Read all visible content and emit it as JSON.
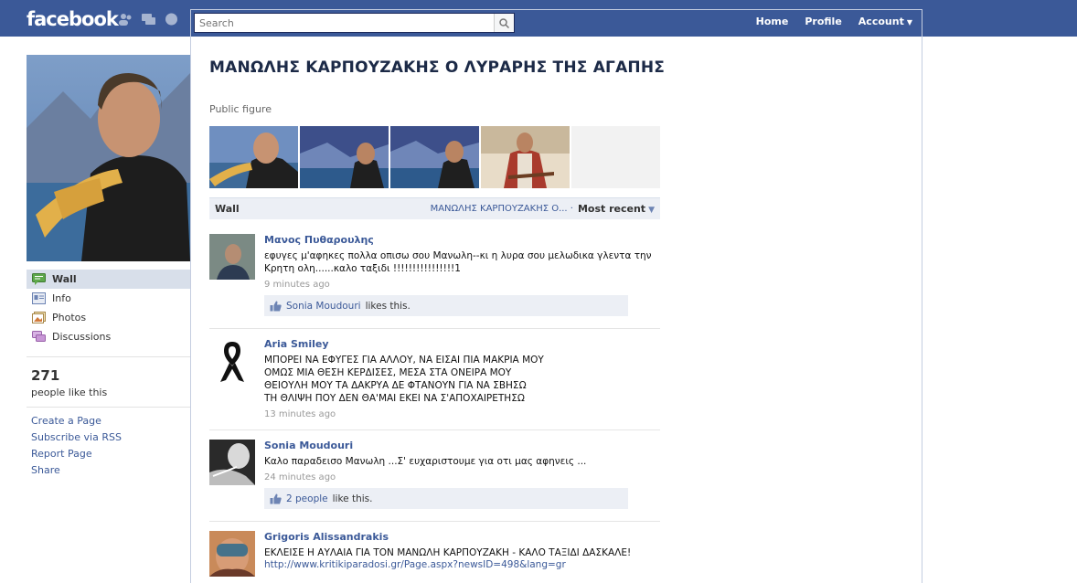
{
  "topbar": {
    "logo": "facebook",
    "search_placeholder": "Search",
    "nav": {
      "home": "Home",
      "profile": "Profile",
      "account": "Account"
    }
  },
  "sidebar": {
    "items": [
      {
        "label": "Wall",
        "icon": "wall-icon"
      },
      {
        "label": "Info",
        "icon": "info-icon"
      },
      {
        "label": "Photos",
        "icon": "photos-icon"
      },
      {
        "label": "Discussions",
        "icon": "discussions-icon"
      }
    ],
    "likes_count": "271",
    "likes_label": "people like this",
    "links": [
      "Create a Page",
      "Subscribe via RSS",
      "Report Page",
      "Share"
    ]
  },
  "page": {
    "title": "ΜΑΝΩΛΗΣ ΚΑΡΠΟΥΖΑΚΗΣ Ο ΛΥΡΑΡΗΣ ΤΗΣ ΑΓΑΠΗΣ",
    "category": "Public figure"
  },
  "wall": {
    "label": "Wall",
    "filter": "ΜΑΝΩΛΗΣ ΚΑΡΠΟΥΖΑΚΗΣ Ο... ·",
    "sort": "Most recent"
  },
  "posts": [
    {
      "author": "Μανος Πυθαρουλης",
      "message": "εφυγες μ'αφηκες πολλα οπισω σου Μανωλη--κι η λυρα σου μελωδικα γλεντα την\nΚρητη ολη......καλο ταξιδι !!!!!!!!!!!!!!!!1",
      "time": "9 minutes ago",
      "likes_who": "Sonia Moudouri",
      "likes_suffix": "likes this."
    },
    {
      "author": "Aria Smiley",
      "message": "ΜΠΟΡΕΙ ΝΑ ΕΦΥΓΕΣ ΓΙΑ ΑΛΛΟΥ, ΝΑ ΕΙΣΑΙ ΠΙΑ ΜΑΚΡΙΑ ΜΟΥ\nΟΜΩΣ ΜΙΑ ΘΕΣΗ ΚΕΡΔΙΣΕΣ, ΜΕΣΑ ΣΤΑ ΟΝΕΙΡΑ ΜΟΥ\nΘΕΙΟΥΛΗ ΜΟΥ ΤΑ ΔΑΚΡΥΑ ΔΕ ΦΤΑΝΟΥΝ ΓΙΑ ΝΑ ΣΒΗΣΩ\nΤΗ ΘΛΙΨΗ ΠΟΥ ΔΕΝ ΘΑ'ΜΑΙ ΕΚΕΙ ΝΑ Σ'ΑΠΟΧΑΙΡΕΤΗΣΩ",
      "time": "13 minutes ago"
    },
    {
      "author": "Sonia Moudouri",
      "message": "Καλο παραδεισο Μανωλη ...Σ' ευχαριστουμε για οτι μας αφηνεις ...",
      "time": "24 minutes ago",
      "likes_who": "2 people",
      "likes_suffix": "like this."
    },
    {
      "author": "Grigoris Alissandrakis",
      "message": "ΕΚΛΕΙΣΕ Η ΑΥΛΑΙΑ ΓΙΑ ΤΟΝ ΜΑΝΩΛΗ ΚΑΡΠΟΥΖΑΚΗ - ΚΑΛΟ ΤΑΞΙΔΙ ΔΑΣΚΑΛΕ!",
      "link": "http://www.kritikiparadosi.gr/Page.aspx?newsID=498&lang=gr"
    }
  ],
  "colors": {
    "brand": "#3b5998",
    "link": "#3b5998",
    "likebox": "#eceff5"
  }
}
